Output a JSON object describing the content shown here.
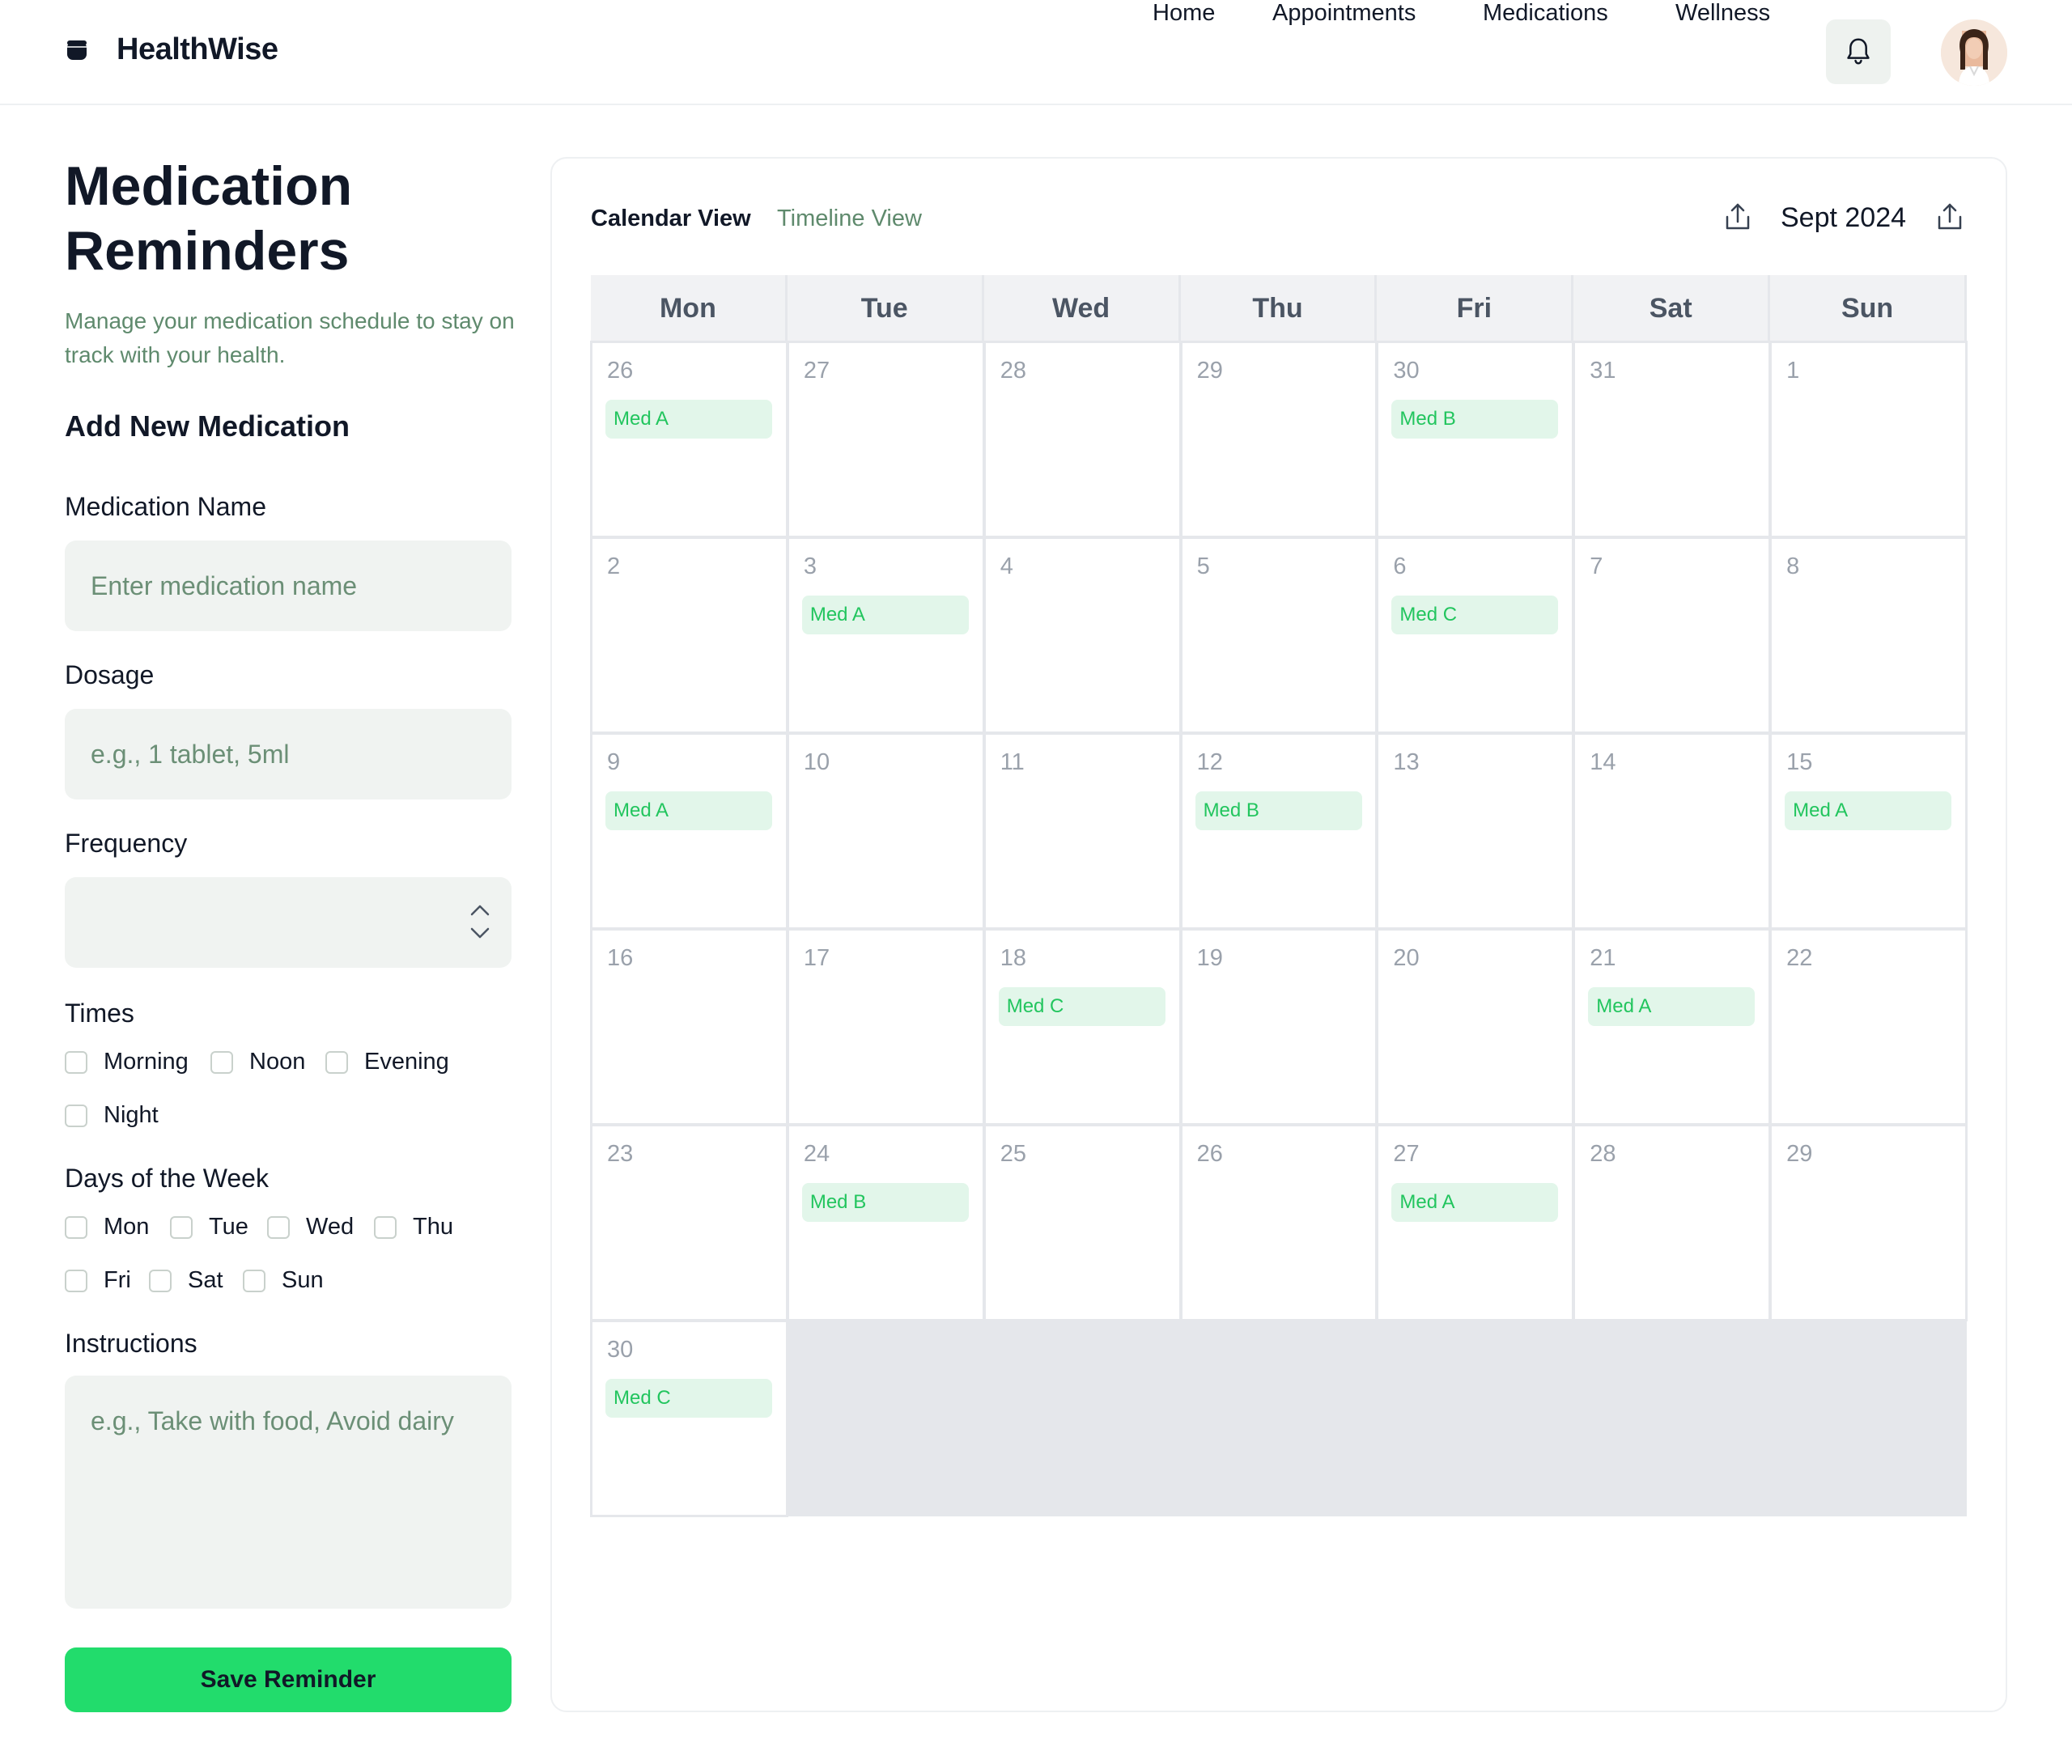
{
  "header": {
    "brand": "HealthWise",
    "nav": [
      {
        "label": "Home"
      },
      {
        "label": "Appointments"
      },
      {
        "label": "Medications"
      },
      {
        "label": "Wellness"
      }
    ]
  },
  "sidebar": {
    "title_line1": "Medication",
    "title_line2": "Reminders",
    "subtitle": "Manage your medication schedule to stay on track with your health.",
    "section_title": "Add New Medication",
    "name_label": "Medication Name",
    "name_placeholder": "Enter medication name",
    "dosage_label": "Dosage",
    "dosage_placeholder": "e.g., 1 tablet, 5ml",
    "frequency_label": "Frequency",
    "frequency_value": "",
    "times_label": "Times",
    "times": [
      "Morning",
      "Noon",
      "Evening",
      "Night"
    ],
    "days_label": "Days of the Week",
    "days": [
      "Mon",
      "Tue",
      "Wed",
      "Thu",
      "Fri",
      "Sat",
      "Sun"
    ],
    "instructions_label": "Instructions",
    "instructions_placeholder": "e.g., Take with food, Avoid dairy",
    "save_label": "Save Reminder"
  },
  "calendar": {
    "tab_calendar": "Calendar View",
    "tab_timeline": "Timeline View",
    "month": "Sept 2024",
    "weekdays": [
      "Mon",
      "Tue",
      "Wed",
      "Thu",
      "Fri",
      "Sat",
      "Sun"
    ],
    "cells": [
      {
        "day": "26",
        "med": "Med A"
      },
      {
        "day": "27",
        "med": ""
      },
      {
        "day": "28",
        "med": ""
      },
      {
        "day": "29",
        "med": ""
      },
      {
        "day": "30",
        "med": "Med B"
      },
      {
        "day": "31",
        "med": ""
      },
      {
        "day": "1",
        "med": ""
      },
      {
        "day": "2",
        "med": ""
      },
      {
        "day": "3",
        "med": "Med A"
      },
      {
        "day": "4",
        "med": ""
      },
      {
        "day": "5",
        "med": ""
      },
      {
        "day": "6",
        "med": "Med C"
      },
      {
        "day": "7",
        "med": ""
      },
      {
        "day": "8",
        "med": ""
      },
      {
        "day": "9",
        "med": "Med A"
      },
      {
        "day": "10",
        "med": ""
      },
      {
        "day": "11",
        "med": ""
      },
      {
        "day": "12",
        "med": "Med B"
      },
      {
        "day": "13",
        "med": ""
      },
      {
        "day": "14",
        "med": ""
      },
      {
        "day": "15",
        "med": "Med A"
      },
      {
        "day": "16",
        "med": ""
      },
      {
        "day": "17",
        "med": ""
      },
      {
        "day": "18",
        "med": "Med C"
      },
      {
        "day": "19",
        "med": ""
      },
      {
        "day": "20",
        "med": ""
      },
      {
        "day": "21",
        "med": "Med A"
      },
      {
        "day": "22",
        "med": ""
      },
      {
        "day": "23",
        "med": ""
      },
      {
        "day": "24",
        "med": "Med B"
      },
      {
        "day": "25",
        "med": ""
      },
      {
        "day": "26",
        "med": ""
      },
      {
        "day": "27",
        "med": "Med A"
      },
      {
        "day": "28",
        "med": ""
      },
      {
        "day": "29",
        "med": ""
      },
      {
        "day": "30",
        "med": "Med C"
      }
    ]
  },
  "colors": {
    "accent": "#22dc6c",
    "muted_green": "#5f8a6d",
    "tag_bg": "#e2f6ea",
    "tag_text": "#22c55e"
  },
  "icons": {
    "brand": "pill-bottle-icon",
    "notifications": "bell-icon",
    "avatar": "user-avatar",
    "prev_month": "share-upload-icon",
    "next_month": "share-upload-icon",
    "select": "chevron-up-down-icon"
  }
}
